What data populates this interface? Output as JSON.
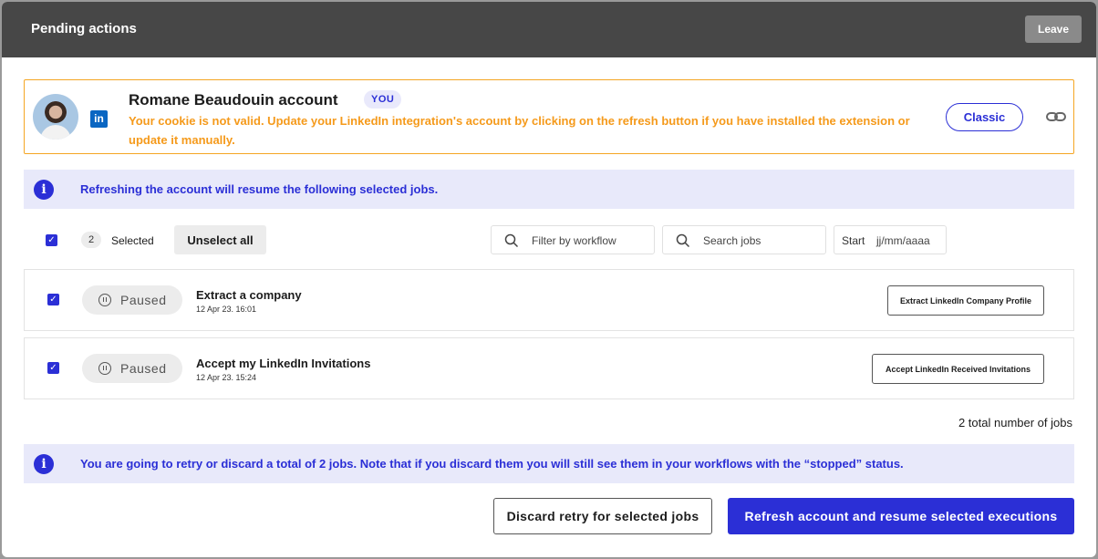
{
  "header": {
    "title": "Pending actions",
    "leave_label": "Leave"
  },
  "account": {
    "name": "Romane Beaudouin account",
    "badge": "YOU",
    "network_icon": "linkedin-icon",
    "warning": "Your cookie is not valid. Update your LinkedIn integration's account by clicking on the refresh button if you have installed the extension or update it manually.",
    "mode_label": "Classic"
  },
  "info_top": {
    "text": "Refreshing the account will resume the following selected jobs."
  },
  "toolbar": {
    "selected_count": "2",
    "selected_label": "Selected",
    "unselect_label": "Unselect all",
    "filter_placeholder": "Filter by workflow",
    "search_placeholder": "Search jobs",
    "start_label": "Start",
    "date_placeholder": "jj/mm/aaaa"
  },
  "jobs": [
    {
      "status": "Paused",
      "title": "Extract a company",
      "date": "12 Apr 23. 16:01",
      "action": "Extract LinkedIn Company Profile",
      "checked": true
    },
    {
      "status": "Paused",
      "title": "Accept my LinkedIn Invitations",
      "date": "12 Apr 23. 15:24",
      "action": "Accept LinkedIn Received Invitations",
      "checked": true
    }
  ],
  "total_jobs": "2 total number of jobs",
  "info_bottom": {
    "text": "You are going to retry or discard a total of 2 jobs. Note that if you discard them you will still see them in your workflows with the “stopped” status."
  },
  "footer": {
    "discard_label": "Discard retry for selected jobs",
    "refresh_label": "Refresh account and resume selected executions"
  },
  "colors": {
    "accent": "#2b2fd6",
    "warning": "#f59a1b",
    "header_bg": "#474747"
  }
}
